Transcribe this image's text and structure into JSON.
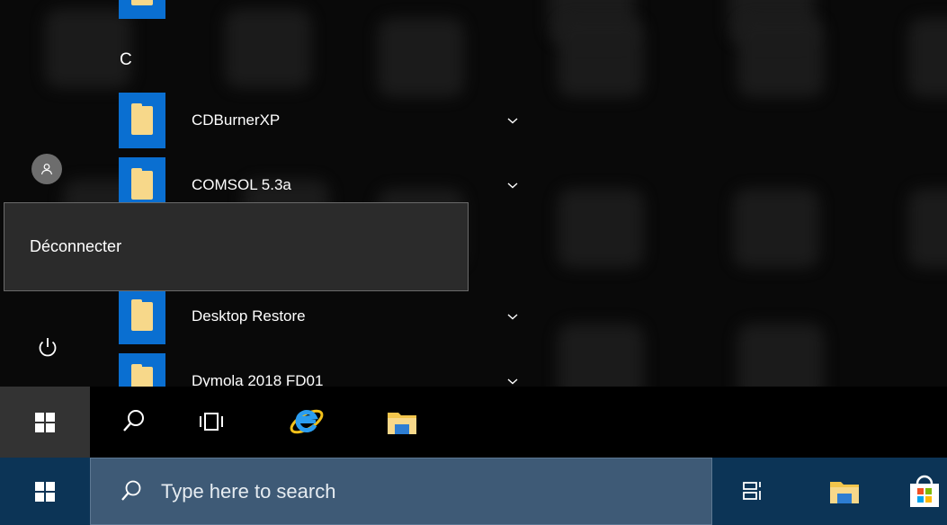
{
  "start_menu": {
    "letter_header": "C",
    "apps": [
      {
        "label": "CDBurnerXP",
        "icon": "folder-icon",
        "expandable": true
      },
      {
        "label": "COMSOL 5.3a",
        "icon": "folder-icon",
        "expandable": true
      },
      {
        "label": "Desktop Restore",
        "icon": "folder-icon",
        "expandable": true
      },
      {
        "label": "Dymola 2018 FD01",
        "icon": "folder-icon",
        "expandable": true
      }
    ],
    "rail": {
      "avatar_icon": "user-icon",
      "power_icon": "power-icon"
    },
    "tooltip": "Déconnecter"
  },
  "inner_taskbar": {
    "icons": [
      "windows-logo-icon",
      "search-icon",
      "task-view-icon",
      "internet-explorer-icon",
      "file-explorer-icon"
    ]
  },
  "taskbar": {
    "search_placeholder": "Type here to search",
    "icons": [
      "windows-logo-icon",
      "search-icon",
      "task-view-icon",
      "file-explorer-icon",
      "store-icon"
    ]
  },
  "colors": {
    "tile_blue": "#0a6fd1",
    "folder_yellow": "#f7d88a",
    "taskbar_blue": "#0c3456",
    "search_box": "#3e5a76",
    "tooltip_bg": "#2b2b2b"
  }
}
